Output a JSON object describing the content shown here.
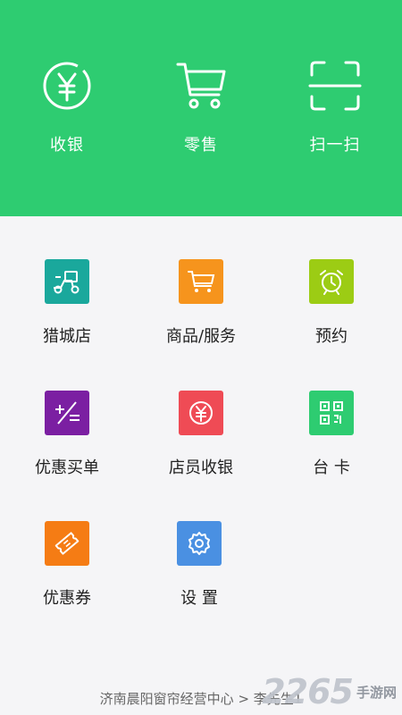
{
  "top_actions": [
    {
      "label": "收银",
      "icon": "yen-circle-icon"
    },
    {
      "label": "零售",
      "icon": "cart-icon"
    },
    {
      "label": "扫一扫",
      "icon": "scan-icon"
    }
  ],
  "grid": [
    {
      "label": "猎城店",
      "icon": "delivery-bike-icon",
      "color": "#1aa89c"
    },
    {
      "label": "商品/服务",
      "icon": "cart-icon",
      "color": "#f6941d"
    },
    {
      "label": "预约",
      "icon": "alarm-clock-icon",
      "color": "#9ccc14"
    },
    {
      "label": "优惠买单",
      "icon": "discount-calc-icon",
      "color": "#7b1fa2"
    },
    {
      "label": "店员收银",
      "icon": "yen-circle-icon",
      "color": "#ef4b55"
    },
    {
      "label": "台 卡",
      "icon": "qr-code-icon",
      "color": "#2ecc71"
    },
    {
      "label": "优惠券",
      "icon": "ticket-icon",
      "color": "#f57c14"
    },
    {
      "label": "设 置",
      "icon": "gear-icon",
      "color": "#4a90e2"
    }
  ],
  "footer": {
    "text": "济南晨阳窗帘经营中心 > 李先生1"
  },
  "watermark": {
    "number": "2265",
    "site": "手游网",
    "cn": ".com"
  },
  "colors": {
    "primary": "#2ecc71",
    "background": "#f5f5f7"
  }
}
